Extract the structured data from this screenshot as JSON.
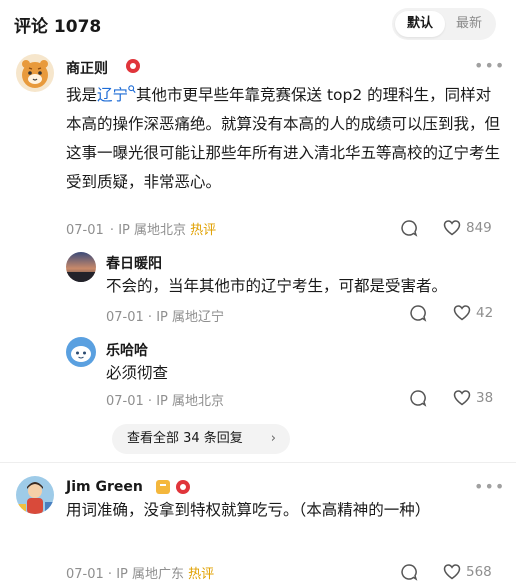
{
  "header": {
    "title": "评论 1078",
    "sort_default": "默认",
    "sort_latest": "最新"
  },
  "comments": [
    {
      "author": "商正则",
      "text_before": "我是",
      "link_text": "辽宁",
      "text_after": "其他市更早些年靠竞赛保送 top2 的理科生，同样对本高的操作深恶痛绝。就算没有本高的人的成绩可以压到我，但这事一曝光很可能让那些年所有进入清北华五等高校的辽宁考生受到质疑，非常恶心。",
      "date": "07-01",
      "location": "IP 属地北京",
      "hot": "热评",
      "likes": "849",
      "replies": [
        {
          "author": "春日暖阳",
          "text": "不会的，当年其他市的辽宁考生，可都是受害者。",
          "date": "07-01",
          "location": "IP 属地辽宁",
          "likes": "42"
        },
        {
          "author": "乐哈哈",
          "text": "必须彻查",
          "date": "07-01",
          "location": "IP 属地北京",
          "likes": "38"
        }
      ],
      "expand_label": "查看全部 34 条回复"
    },
    {
      "author": "Jim Green",
      "text": "用词准确，没拿到特权就算吃亏。（本高精神的一种）",
      "date": "07-01",
      "location": "IP 属地广东",
      "hot": "热评",
      "likes": "568"
    }
  ],
  "colors": {
    "link": "#1e6cd6",
    "hot": "#e0a000",
    "meta": "#8f8f8f"
  },
  "icons": [
    "more-icon",
    "comment-icon",
    "heart-icon",
    "search-icon",
    "chevron-right-icon"
  ]
}
